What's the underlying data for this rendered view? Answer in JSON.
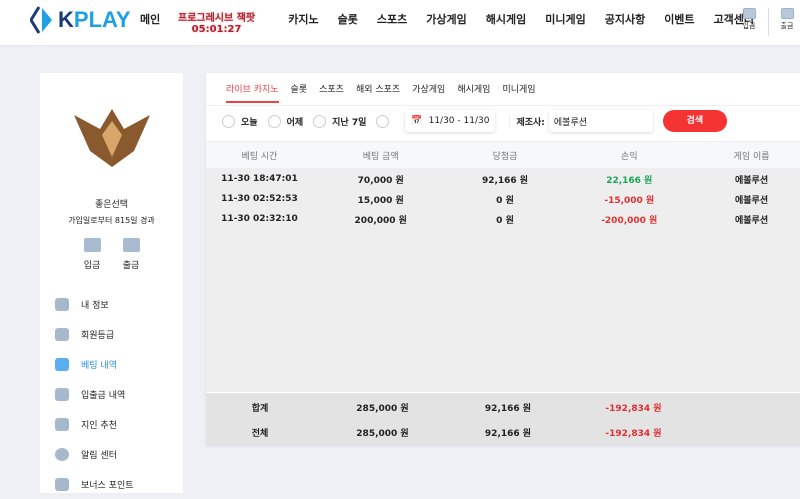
{
  "header": {
    "logo": "KPLAY",
    "nav": [
      "메인",
      "카지노",
      "슬롯",
      "스포츠",
      "가상게임",
      "해시게임",
      "미니게임",
      "공지사항",
      "이벤트",
      "고객센터"
    ],
    "jackpot_label": "프로그레시브 잭팟",
    "jackpot_timer": "05:01:27",
    "deposit": "입금",
    "withdraw": "출금"
  },
  "sidebar": {
    "username": "좋은선택",
    "days": "가입일로부터 815일 경과",
    "deposit": "입금",
    "withdraw": "출금",
    "items": [
      {
        "label": "내 정보"
      },
      {
        "label": "회원등급"
      },
      {
        "label": "베팅 내역",
        "active": true
      },
      {
        "label": "입출금 내역"
      },
      {
        "label": "지인 추천"
      },
      {
        "label": "알림 센터"
      },
      {
        "label": "보너스 포인트"
      }
    ]
  },
  "main": {
    "tabs": [
      "라이브 카지노",
      "슬롯",
      "스포츠",
      "해외 스포츠",
      "가상게임",
      "해시게임",
      "미니게임"
    ],
    "filters": {
      "today": "오늘",
      "yesterday": "어제",
      "last7": "지난 7일",
      "date_range": "11/30 - 11/30",
      "provider_label": "제조사:",
      "provider_value": "에볼루션",
      "search": "검색"
    },
    "columns": [
      "베팅 시간",
      "베팅 금액",
      "당첨금",
      "손익",
      "게임 이름"
    ],
    "rows": [
      [
        "11-30 18:47:01",
        "70,000 원",
        "92,166 원",
        "22,166 원",
        "에볼루션"
      ],
      [
        "11-30 02:52:53",
        "15,000 원",
        "0 원",
        "-15,000 원",
        "에볼루션"
      ],
      [
        "11-30 02:32:10",
        "200,000 원",
        "0 원",
        "-200,000 원",
        "에볼루션"
      ]
    ],
    "totals": [
      [
        "합계",
        "285,000 원",
        "92,166 원",
        "-192,834 원"
      ],
      [
        "전체",
        "285,000 원",
        "92,166 원",
        "-192,834 원"
      ]
    ]
  },
  "colors": {
    "accent": "#f53333",
    "positive": "#1aa35a",
    "negative": "#e03030",
    "active_menu": "#2a8ee6"
  }
}
